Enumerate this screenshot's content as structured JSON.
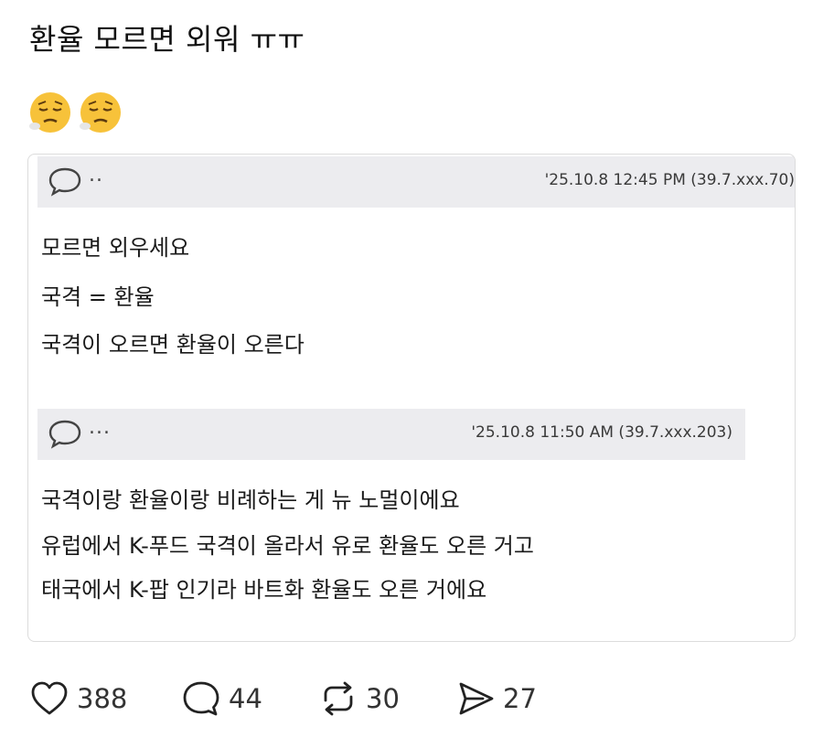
{
  "post": {
    "title": "환율 모르면 외워 ㅠㅠ",
    "emoji": [
      "tired-face-emoji",
      "tired-face-emoji"
    ]
  },
  "card": {
    "comment1": {
      "dots": "..",
      "meta": "'25.10.8 12:45 PM (39.7.xxx.70)",
      "lines": [
        "모르면 외우세요",
        "국격 = 환율",
        "국격이 오르면 환율이 오른다"
      ]
    },
    "comment2": {
      "dots": "...",
      "meta": "'25.10.8 11:50 AM (39.7.xxx.203)",
      "lines": [
        "국격이랑 환율이랑 비례하는 게 뉴 노멀이에요",
        "유럽에서 K-푸드 국격이 올라서 유로 환율도 오른 거고",
        "태국에서 K-팝 인기라 바트화 환율도 오른 거에요"
      ]
    }
  },
  "actions": {
    "likes": "388",
    "comments": "44",
    "reposts": "30",
    "shares": "27"
  },
  "icons": {
    "like": "heart-icon",
    "comment": "speech-bubble-icon",
    "repost": "repost-icon",
    "share": "send-icon"
  },
  "colors": {
    "meta_bar": "#ececef",
    "emoji_face": "#f7c23a"
  }
}
